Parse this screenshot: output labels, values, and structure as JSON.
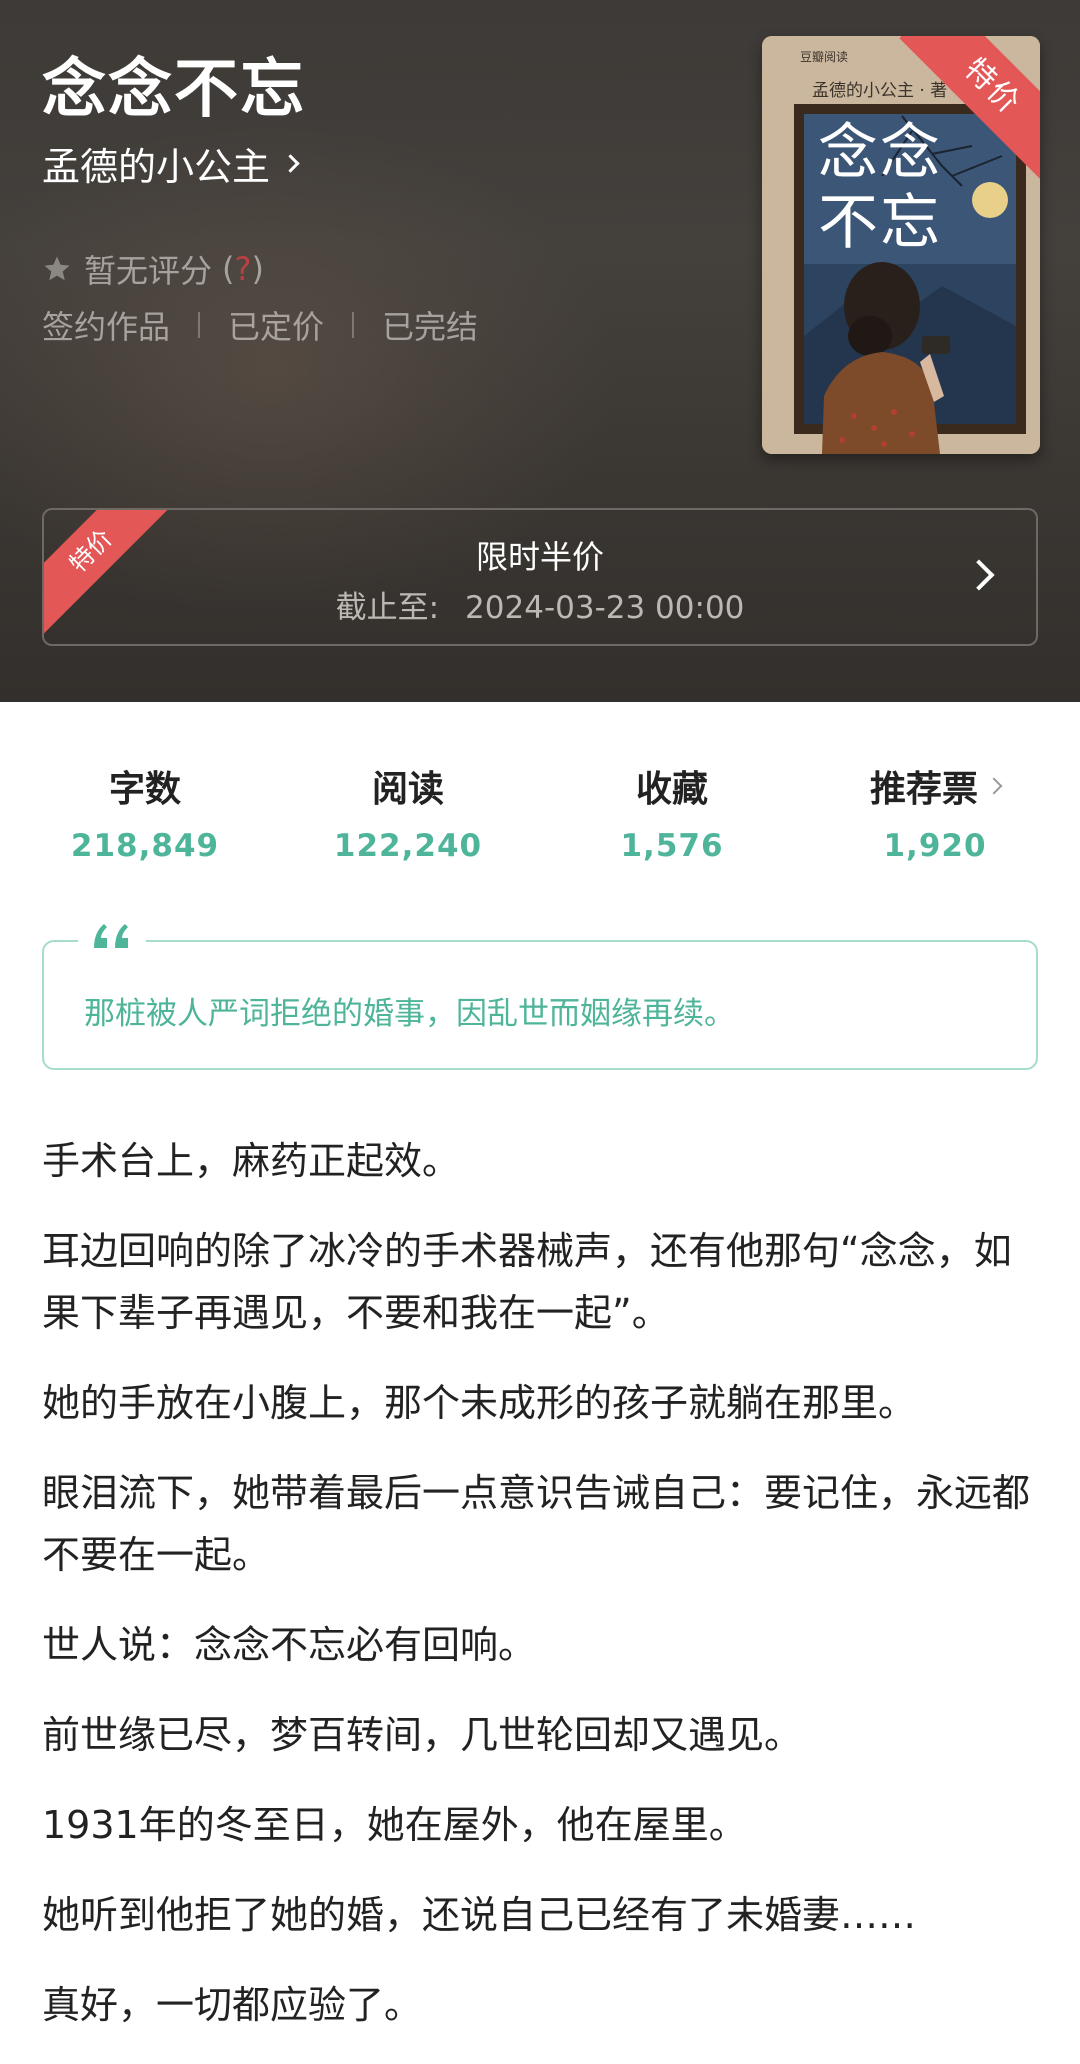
{
  "book": {
    "title": "念念不忘",
    "author": "孟德的小公主",
    "rating_text": "暂无评分",
    "rating_paren_open": "(",
    "rating_q": "?",
    "rating_paren_close": ")",
    "tags": [
      "签约作品",
      "已定价",
      "已完结"
    ]
  },
  "cover": {
    "logo": "豆瓣阅读",
    "author_line": "孟德的小公主 · 著",
    "title_line1": "念念",
    "title_line2": "不忘",
    "ribbon": "特价"
  },
  "promo": {
    "ribbon": "特价",
    "title": "限时半价",
    "deadline_label": "截止至:",
    "deadline_value": "2024-03-23 00:00"
  },
  "stats": [
    {
      "label": "字数",
      "value": "218,849"
    },
    {
      "label": "阅读",
      "value": "122,240"
    },
    {
      "label": "收藏",
      "value": "1,576"
    },
    {
      "label": "推荐票",
      "value": "1,920"
    }
  ],
  "quote": {
    "text": "那桩被人严词拒绝的婚事，因乱世而姻缘再续。"
  },
  "paragraphs": [
    "手术台上，麻药正起效。",
    "耳边回响的除了冰冷的手术器械声，还有他那句“念念，如果下辈子再遇见，不要和我在一起”。",
    "她的手放在小腹上，那个未成形的孩子就躺在那里。",
    "眼泪流下，她带着最后一点意识告诫自己：要记住，永远都不要在一起。",
    "世人说：念念不忘必有回响。",
    "前世缘已尽，梦百转间，几世轮回却又遇见。",
    "1931年的冬至日，她在屋外，他在屋里。",
    "她听到他拒了她的婚，还说自己已经有了未婚妻……",
    "真好，一切都应验了。"
  ],
  "colors": {
    "accent": "#4fb59a",
    "ribbon": "#e35757",
    "header_bg": "#3d3a37"
  }
}
